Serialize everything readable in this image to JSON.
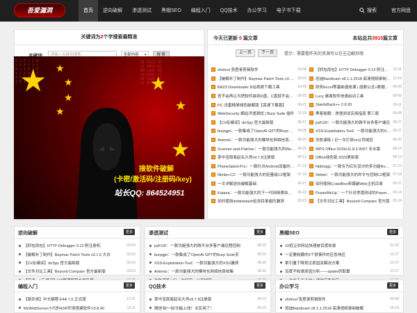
{
  "header": {
    "logo_text": "吾爱漏洞",
    "nav": [
      "首页",
      "逆向破解",
      "渗透测试",
      "黑帽SEO",
      "编程入门",
      "QQ技术",
      "办公学习",
      "电子书下载"
    ],
    "search_label": "搜索",
    "brand_label": "官方网盘"
  },
  "keyword": {
    "title_pre": "关键词为",
    "count": "2",
    "title_post": "个字搜索最精准",
    "label": "关键词:",
    "placeholder": "请输入关键词搜索...",
    "select_value": "全部内容",
    "button": "搜 索"
  },
  "banner": {
    "line1": "接软件破解",
    "line2": "(卡密/激活码/注册码/key)",
    "line3": "站长QQ: 864524951"
  },
  "today": {
    "pre": "今天已更新",
    "count": "0",
    "post": "篇文章",
    "total_pre": "本站总共",
    "total": "3915",
    "total_post": "篇文章",
    "prev": "上一页",
    "next": "下一页",
    "tip": "提示：需要看昨天的资源可以在左边翻页哦"
  },
  "today_left": [
    {
      "t": "shotcut 免登录剪辑软件",
      "d": "03-08"
    },
    {
      "t": "【破解补丁制作】Baymax Patch Tools v3.1.0 大白",
      "d": "03-03"
    },
    {
      "t": "Bili23 Downloader B站视频下载工具",
      "d": "10-09"
    },
    {
      "t": "吾不会再以为把软件装到D盘，C盘就不会满了",
      "d": "09-20"
    },
    {
      "t": "PC 迅雷精简绿色破解版【高速下载版】",
      "d": "08-22"
    },
    {
      "t": "WebSecurity 網站滲透測試 | Burp Suite 插件",
      "d": "11-18"
    },
    {
      "t": "【C#反编译】dnSpy 官方最新版",
      "d": "08-27"
    },
    {
      "t": "burpgpt：一款集成了OpenAI GPT的Burp Suite",
      "d": "09-08"
    },
    {
      "t": "Artemis：一款功能强大的模块化网络信息收集",
      "d": "08-20"
    },
    {
      "t": "Scanner-and-Patcher：一款功能强大的Web漏洞",
      "d": "08-20"
    },
    {
      "t": "掌中宝周易起名大师v9.7.8注册版",
      "d": "08-13"
    },
    {
      "t": "PhoneSploit-Pro：一款针对Android设备的渗透",
      "d": "07-18"
    },
    {
      "t": "Nimbo-C2：一款功能强大的轻量级C2框架",
      "d": "07-18"
    },
    {
      "t": "一文详解逆向破解基础",
      "d": "06-27"
    },
    {
      "t": "Katana：一款功能强大的下一代网络爬虫框架",
      "d": "06-18"
    },
    {
      "t": "如何使用dotdotslash检测目录遍历漏洞",
      "d": "05-23"
    }
  ],
  "today_right": [
    {
      "t": "【抓包改包】HTTP Debugger 9.12 附注册机",
      "d": "11-01"
    },
    {
      "t": "班迪Bandicam v8.1.1.2518 高清视频录制破解",
      "d": "10-19"
    },
    {
      "t": "财务Excel等基础速成课 | 函数公式+数据透视",
      "d": "09-09"
    },
    {
      "t": "Lucy 桌面软件快速启动工具",
      "d": "09-09"
    },
    {
      "t": "StartIsBack++ 2.9.20",
      "d": "09-11"
    },
    {
      "t": "黑客秘籍：渗透测试实用指南 第三版",
      "d": "09-08"
    },
    {
      "t": "pyFUD：一款功能强大的跨平台多客户端远",
      "d": "08-27"
    },
    {
      "t": "XSS-Exploitation-Tool：一款功能强大的XSS",
      "d": "08-27"
    },
    {
      "t": "攻防演练 | 记一次打穿xx公司域控",
      "d": "08-20"
    },
    {
      "t": "WPS Office 2019v11.8.2.9067 专业版",
      "d": "08-14"
    },
    {
      "t": "Office绿色版 2023更新版",
      "d": "08-13"
    },
    {
      "t": "Nidhogg：一款专为红队设计的多功能Rootkit",
      "d": "07-19"
    },
    {
      "t": "Striker：一款功能强大的命令与控制C2框架",
      "d": "07-18"
    },
    {
      "t": "如何使用CrawlBox来爆破Web主机目录",
      "d": "06-27"
    },
    {
      "t": "PowerMeUp：一个针对渗透测试的PowerShell",
      "d": "06-13"
    },
    {
      "t": "【文件对比工具】Beyond Compare 官方版",
      "d": "05-24"
    }
  ],
  "sections": [
    {
      "title": "逆向破解",
      "more": "更多",
      "items": [
        {
          "t": "【抓包改包】HTTP Debugger 9.12 附注册机",
          "d": "03-03"
        },
        {
          "t": "【破解补丁制作】Baymax Patch Tools v3.1.0 大白",
          "d": "03-03"
        },
        {
          "t": "【C#反编译】dnSpy 官方最新版",
          "d": "03-03"
        },
        {
          "t": "【文件对比工具】Beyond Compare 官方最新版",
          "d": "03-03"
        },
        {
          "t": "【安卓apk反编译】MT管理器官方最新版",
          "d": "02-26"
        }
      ]
    },
    {
      "title": "渗透测试",
      "more": "更多",
      "items": [
        {
          "t": "pyFUD：一款功能强大的跨平台多客户端远程控制",
          "d": "08-20"
        },
        {
          "t": "burpgpt：一款集成了OpenAI GPT的Burp Suite安",
          "d": "08-20"
        },
        {
          "t": "XSS-Exploitation-Tool：一款功能强大的XSS漏洞",
          "d": "08-20"
        },
        {
          "t": "Artemis：一款功能强大的模块化网络信息收集",
          "d": "08-20"
        },
        {
          "t": "攻防演练 | 记一次打穿xx公司域控",
          "d": "08-20"
        }
      ]
    },
    {
      "title": "黑帽SEO",
      "more": "更多",
      "items": [
        {
          "t": "10招让你网站快速被百度收录",
          "d": "01-30"
        },
        {
          "t": "一定要收藏的5个很事件的应急响应",
          "d": "12-27"
        },
        {
          "t": "索引量下降常见原因及解决方案",
          "d": "12-27"
        },
        {
          "t": "百度不收录原因分析——spider抓取篇",
          "d": "12-27"
        },
        {
          "t": "一次关于企业被入侵的应急响应",
          "d": "12-27"
        }
      ]
    },
    {
      "title": "编程入门",
      "more": "更多",
      "items": [
        {
          "t": "【易安卓】中文编程 E4A 7.0 正式版",
          "d": "12-31"
        },
        {
          "t": "MyWebServer小巧的ASP环境搭建软件V3.8.40",
          "d": "12-11"
        }
      ]
    },
    {
      "title": "QQ技术",
      "more": "更多",
      "items": [
        {
          "t": "掌中宝周易起名大师v9.7.8注册版",
          "d": "08-13"
        },
        {
          "t": "微信'拍一拍'功能上线！太实用了！",
          "d": "06-29"
        }
      ]
    },
    {
      "title": "办公学习",
      "more": "更多",
      "items": [
        {
          "t": "shotcut 免登录剪辑软件",
          "d": "03-08"
        },
        {
          "t": "班迪Bandicam v8.1.1.2518 高清视频录制破解",
          "d": "10-19"
        }
      ]
    }
  ]
}
